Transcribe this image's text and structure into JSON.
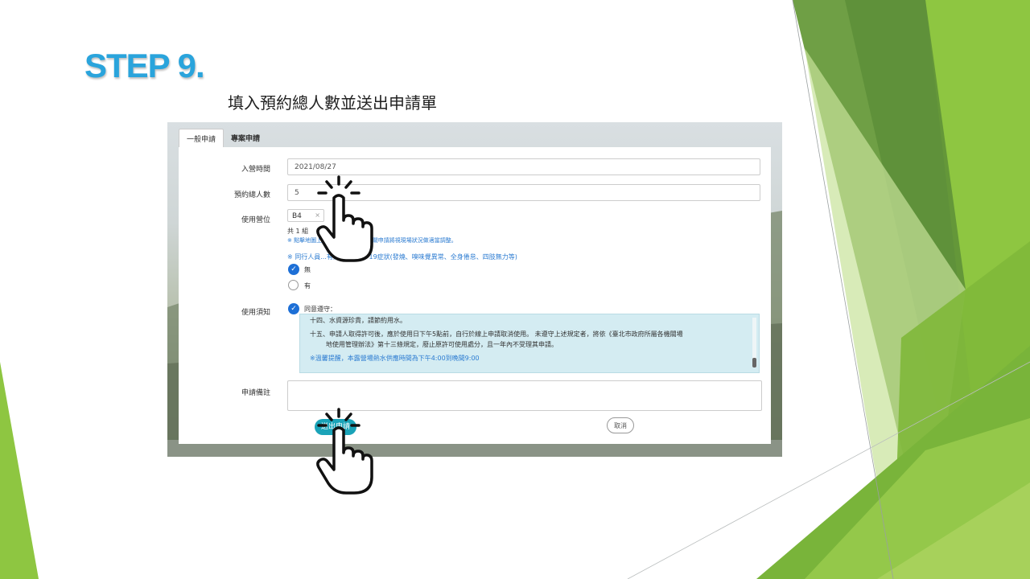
{
  "slide": {
    "step_title": "STEP 9.",
    "subtitle": "填入預約總人數並送出申請單"
  },
  "tabs": [
    {
      "label": "一般申請",
      "active": true
    },
    {
      "label": "專案申請",
      "active": false
    }
  ],
  "form": {
    "date_label": "入營時間",
    "date_value": "2021/08/27",
    "people_label": "預約總人數",
    "people_value": "5",
    "site_label": "使用營位",
    "site_tag": "B4",
    "site_tag_remove": "×",
    "site_count": "共 1 組",
    "site_note": "※ 點擊地圖上...本欄使用營位，有關申請將視現場狀況做適當調整。",
    "covid_question": "※ 同行人員...有疑似COVID-19症狀(發燒、嗅味覺異常、全身倦怠、四肢無力等)",
    "covid_options": [
      "無",
      "有"
    ],
    "covid_selected": "無",
    "rules_label": "使用須知",
    "agree_label": "同意遵守：",
    "notice_lines": [
      "十四、水資源珍貴，請節約用水。",
      "十五、申請人取得許可後，應於使用日下午5點前，自行於線上申請取消使用。 未遵守上述規定者，將依《臺北市政府所屬各機關場",
      "地使用管理辦法》第十三條規定，廢止原許可使用處分，且一年內不受理其申請。",
      "※溫馨提醒，本露營場熱水供應時間為下午4:00到晚間9:00"
    ],
    "remarks_label": "申請備註",
    "submit_label": "送出申請",
    "cancel_label": "取消"
  },
  "colors": {
    "title_blue": "#2aa4dc",
    "accent_teal": "#1aa3b8",
    "check_blue": "#1d6fd6",
    "notice_bg": "#d4ecf2",
    "green_dark": "#5f8f3a",
    "green_light": "#8cc63f"
  },
  "icons": [
    "hand-pointer-icon",
    "check-icon"
  ]
}
